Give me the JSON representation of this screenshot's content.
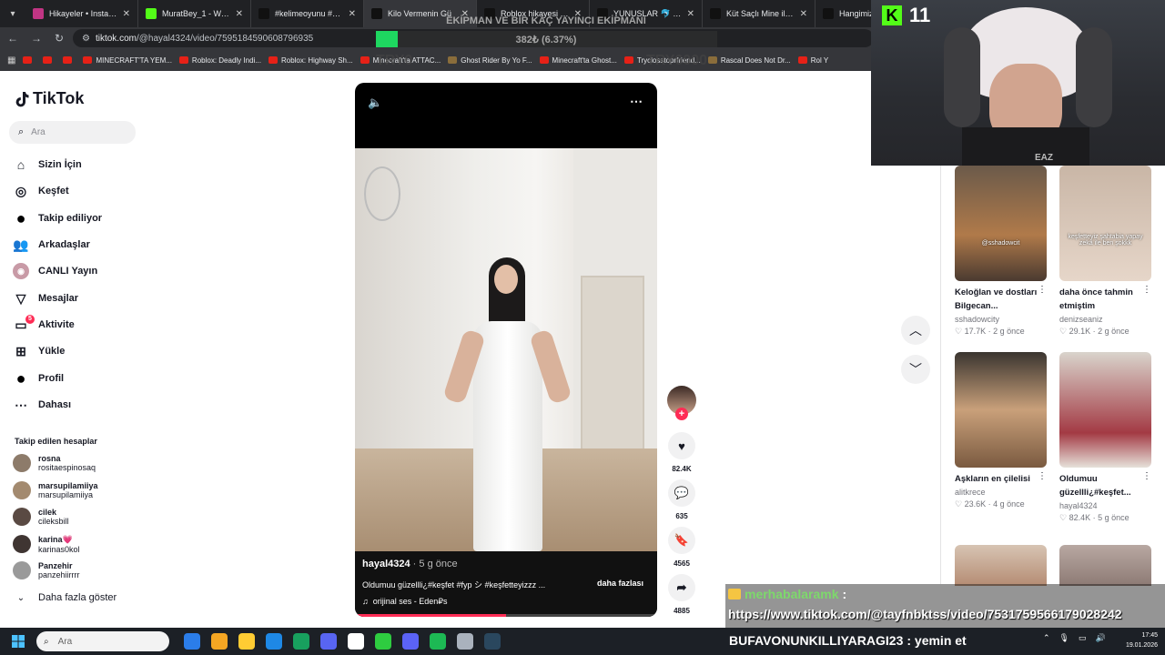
{
  "browser": {
    "tabs": [
      {
        "title": "Hikayeler • Instagram",
        "color": "#c13584",
        "active": false
      },
      {
        "title": "MuratBey_1 - Watch",
        "color": "#53fc18",
        "active": false
      },
      {
        "title": "#kelimeoyunu #aliihs",
        "color": "#111111",
        "active": false
      },
      {
        "title": "Kilo Vermenin Gü",
        "color": "#111111",
        "active": true
      },
      {
        "title": "Roblox hikayesi | Tik",
        "color": "#111111",
        "active": false
      },
      {
        "title": "YUNUSLAR 🐬 HER Y",
        "color": "#111111",
        "active": false
      },
      {
        "title": "Küt Saçlı Mine ile Keş",
        "color": "#111111",
        "active": false
      },
      {
        "title": "Hangimizin A",
        "color": "#111111",
        "active": false
      }
    ],
    "url_host": "tiktok.com",
    "url_path": "/@hayal4324/video/7595184590608796935",
    "bookmarks": [
      {
        "label": "",
        "kind": "yt"
      },
      {
        "label": "",
        "kind": "yt"
      },
      {
        "label": "",
        "kind": "yt"
      },
      {
        "label": "MINECRAFT'TA YEM...",
        "kind": "yt"
      },
      {
        "label": "Roblox: Deadly Indi...",
        "kind": "yt"
      },
      {
        "label": "Roblox: Highway Sh...",
        "kind": "yt"
      },
      {
        "label": "Minecraft'ta ATTAC...",
        "kind": "yt"
      },
      {
        "label": "Ghost Rider By Yo F...",
        "kind": "other"
      },
      {
        "label": "Minecraft'ta Ghost...",
        "kind": "yt"
      },
      {
        "label": "Tryclosstoprfriend...",
        "kind": "yt"
      },
      {
        "label": "Rascal Does Not Dr...",
        "kind": "other"
      },
      {
        "label": "Rol Y",
        "kind": "yt"
      }
    ]
  },
  "overlay": {
    "goal_title": "EKİPMAN VE BİR KAÇ YAYINCI EKİPMANI",
    "goal_progress_text": "382₺ (6.37%)",
    "goal_progress_fraction": 0.0637,
    "goal_min": "TRY0",
    "goal_max": "TRY6000"
  },
  "tiktok": {
    "brand": "TikTok",
    "search_placeholder": "Ara",
    "nav": [
      {
        "label": "Sizin İçin",
        "icon": "home-icon"
      },
      {
        "label": "Keşfet",
        "icon": "compass-icon"
      },
      {
        "label": "Takip ediliyor",
        "icon": "following-icon"
      },
      {
        "label": "Arkadaşlar",
        "icon": "friends-icon"
      },
      {
        "label": "CANLI Yayın",
        "icon": "live-icon"
      },
      {
        "label": "Mesajlar",
        "icon": "messages-icon"
      },
      {
        "label": "Aktivite",
        "icon": "activity-icon",
        "badge": "5"
      },
      {
        "label": "Yükle",
        "icon": "upload-icon"
      },
      {
        "label": "Profil",
        "icon": "profile-icon"
      },
      {
        "label": "Dahası",
        "icon": "more-icon"
      }
    ],
    "following_title": "Takip edilen hesaplar",
    "following": [
      {
        "name": "rosna",
        "handle": "rositaespinosaq"
      },
      {
        "name": "marsupilamiiya",
        "handle": "marsupilamiiya"
      },
      {
        "name": "cilek",
        "handle": "cileksbill"
      },
      {
        "name": "karina💗",
        "handle": "karinas0kol"
      },
      {
        "name": "Panzehir",
        "handle": "panzehiirrrr"
      }
    ],
    "show_more": "Daha fazla göster",
    "video": {
      "author": "hayal4324",
      "age": "· 5 g önce",
      "caption": "Oldumuu güzellli¿#keşfet #fyp シ #keşfetteyizzz ...",
      "more": "daha fazlası",
      "sound": "orijinal ses - Eden₽s",
      "progress_fraction": 0.5
    },
    "actions": {
      "likes": "82.4K",
      "comments": "635",
      "saves": "4565",
      "shares": "4885"
    },
    "cards": [
      {
        "title": "Keloğlan ve dostları Bilgecan...",
        "author": "sshadowcity",
        "likes": "17.7K",
        "age": "2 g önce",
        "thumb_text": "@sshadowcit"
      },
      {
        "title": "daha önce tahmin etmiştim",
        "author": "denizseaniz",
        "likes": "29.1K",
        "age": "2 g önce",
        "thumb_text": "keşfetteyiz şahtabia yapay zekâ ile ben şokkk"
      },
      {
        "title": "Aşkların en çilelisi",
        "author": "alitkrece",
        "likes": "23.6K",
        "age": "4 g önce",
        "thumb_text": ""
      },
      {
        "title": "Oldumuu güzellli¿#keşfet...",
        "author": "hayal4324",
        "likes": "82.4K",
        "age": "5 g önce",
        "thumb_text": ""
      }
    ]
  },
  "stream": {
    "kick_count": "11",
    "webcam_label": "EAZ",
    "chat": [
      {
        "user": "merhabalaramk",
        "text": ":",
        "user_color": "#7dd96b"
      },
      {
        "user": "",
        "text": "https://www.tiktok.com/@tayfnbktss/video/7531759566179028242",
        "user_color": "#ffffff"
      },
      {
        "user": "BUFAVONUNKILLIYARAGI23",
        "text": ": yemin et",
        "user_color": "#ffffff"
      }
    ]
  },
  "taskbar": {
    "search_placeholder": "Ara",
    "time": "17:45",
    "date": "19.01.2026",
    "apps": [
      "#2b7de9",
      "#f5a623",
      "#ffcc33",
      "#1e88e5",
      "#18a05e",
      "#5865f2",
      "#ffffff",
      "#2ecc40",
      "#5b63f6",
      "#1db954",
      "#aab2bd",
      "#2a475e"
    ]
  }
}
